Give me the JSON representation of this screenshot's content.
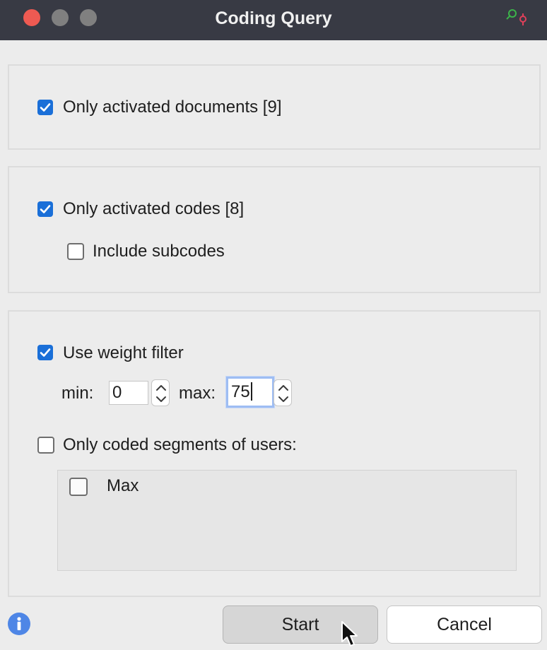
{
  "window": {
    "title": "Coding Query",
    "icon": "search-code-icon"
  },
  "documents": {
    "only_activated_label": "Only activated documents [9]",
    "only_activated_checked": true
  },
  "codes": {
    "only_activated_label": "Only activated codes [8]",
    "only_activated_checked": true,
    "include_subcodes_label": "Include subcodes",
    "include_subcodes_checked": false
  },
  "weight": {
    "use_filter_label": "Use weight filter",
    "use_filter_checked": true,
    "min_label": "min:",
    "min_value": "0",
    "max_label": "max:",
    "max_value": "75"
  },
  "users": {
    "only_coded_label": "Only coded segments of users:",
    "only_coded_checked": false,
    "list": [
      {
        "name": "Max",
        "checked": false
      }
    ]
  },
  "buttons": {
    "start": "Start",
    "cancel": "Cancel"
  },
  "colors": {
    "checkbox_checked": "#1a6fd8",
    "titlebar": "#383a44",
    "close": "#ee5a52",
    "info": "#4e86e6"
  }
}
